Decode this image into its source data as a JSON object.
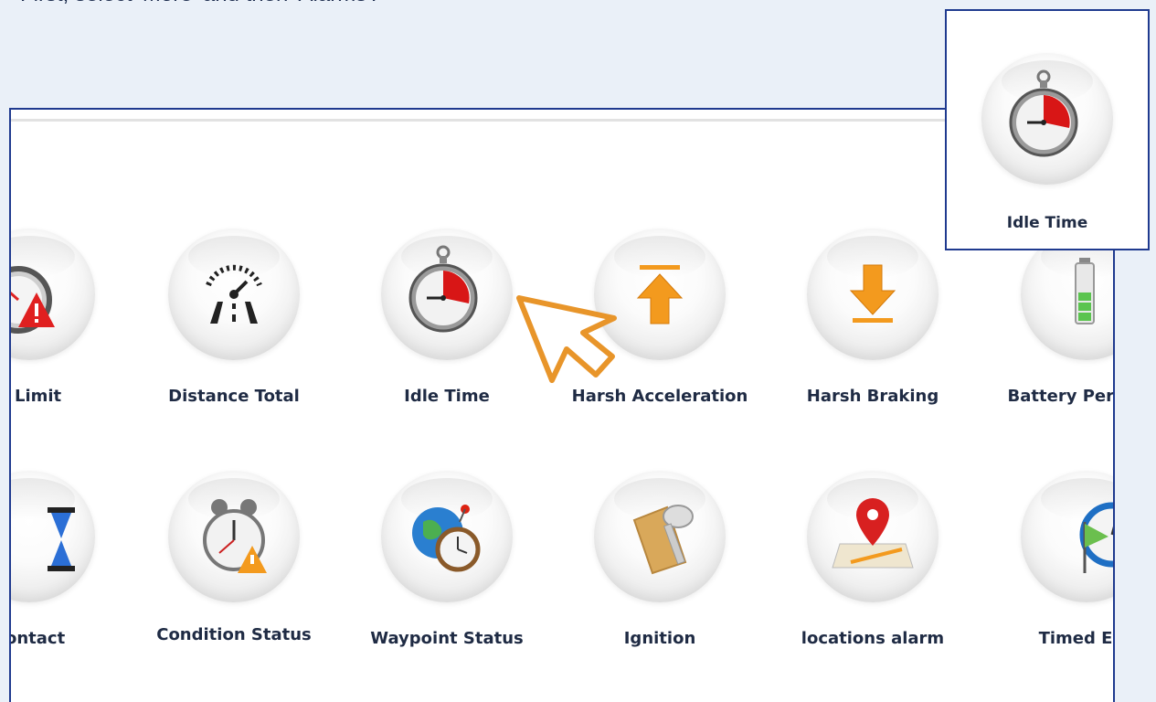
{
  "instruction": "First, select 'More' and then 'Alarms'.",
  "alarms_row1": [
    {
      "label": "d Limit",
      "icon": "speed-limit-icon"
    },
    {
      "label": "Distance Total",
      "icon": "speedometer-icon"
    },
    {
      "label": "Idle Time",
      "icon": "stopwatch-icon"
    },
    {
      "label": "Harsh Acceleration",
      "icon": "arrow-up-icon"
    },
    {
      "label": "Harsh Braking",
      "icon": "arrow-down-icon"
    },
    {
      "label": "Battery Percenta",
      "icon": "battery-icon"
    }
  ],
  "alarms_row2": [
    {
      "label": "Contact",
      "icon": "hourglass-icon"
    },
    {
      "label": "Condition Status",
      "icon": "alarm-clock-icon"
    },
    {
      "label": "Waypoint Status",
      "icon": "globe-clock-icon"
    },
    {
      "label": "Ignition",
      "icon": "key-icon"
    },
    {
      "label": "locations alarm",
      "icon": "map-pin-icon"
    },
    {
      "label": "Timed Eve",
      "icon": "timer-flag-icon"
    }
  ],
  "zoom_callout": {
    "label": "Idle Time",
    "icon": "stopwatch-icon"
  },
  "colors": {
    "accent_border": "#1f3a8f",
    "pointer": "#e8952a",
    "danger": "#e02020",
    "orange": "#f39a1e"
  }
}
